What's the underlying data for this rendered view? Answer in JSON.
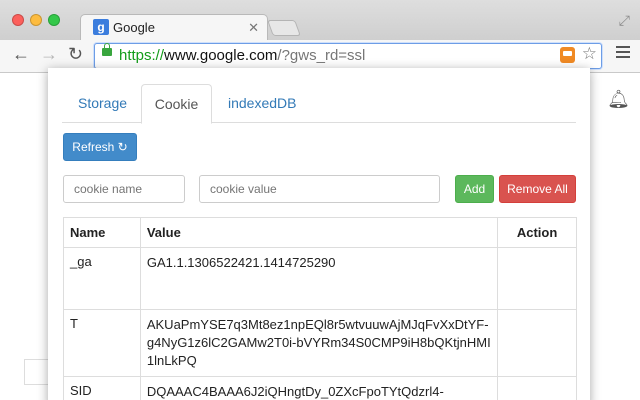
{
  "browser": {
    "tab_title": "Google",
    "tab_favicon": "g-icon",
    "url_scheme": "https://",
    "url_host": "www.google.com",
    "url_rest": "/?gws_rd=ssl"
  },
  "popup": {
    "tabs": [
      "Storage",
      "Cookie",
      "indexedDB"
    ],
    "active_tab": "Cookie",
    "refresh_label": "Refresh",
    "name_placeholder": "cookie name",
    "value_placeholder": "cookie value",
    "add_label": "Add",
    "remove_all_label": "Remove All",
    "table": {
      "headers": [
        "Name",
        "Value",
        "Action"
      ],
      "rows": [
        {
          "name": "_ga",
          "value": "GA1.1.1306522421.1414725290"
        },
        {
          "name": "T",
          "value": "AKUaPmYSE7q3Mt8ez1npEQl8r5wtvuuwAjMJqFvXxDtYF-g4NyG1z6lC2GAMw2T0i-bVYRm34S0CMP9iH8bQKtjnHMI1lnLkPQ"
        },
        {
          "name": "SID",
          "value": "DQAAAC4BAAA6J2iQHngtDy_0ZXcFpoTYtQdzrl4-"
        }
      ]
    }
  },
  "colors": {
    "primary": "#428bca",
    "success": "#5cb85c",
    "danger": "#d9534f",
    "link": "#337ab7",
    "url_green": "#139c1a"
  }
}
